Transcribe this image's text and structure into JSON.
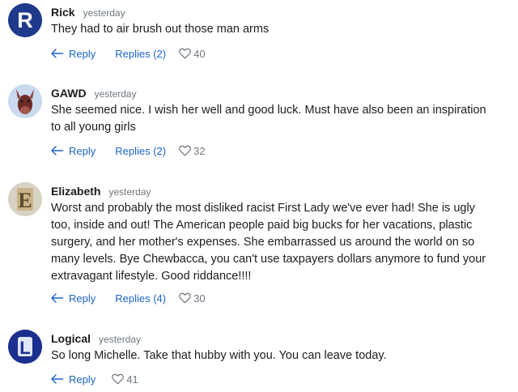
{
  "comments": [
    {
      "author": "Rick",
      "time": "yesterday",
      "text": "They had to air brush out those man arms",
      "reply_label": "Reply",
      "replies_label": "Replies (2)",
      "likes": "40",
      "avatar_letter": "R",
      "avatar_color": "#1f3a8a"
    },
    {
      "author": "GAWD",
      "time": "yesterday",
      "text_lines": [
        "She seemed nice. I wish her well and good luck. Must have also been an inspiration",
        "to all young girls"
      ],
      "reply_label": "Reply",
      "replies_label": "Replies (2)",
      "likes": "32",
      "avatar_color": "#c9d9ee"
    },
    {
      "author": "Elizabeth",
      "time": "yesterday",
      "text_lines": [
        "Worst and probably the most disliked racist First Lady we've ever had! She is ugly",
        "too, inside and out! The American people paid big bucks for her vacations, plastic",
        "surgery, and her mother's expenses. She embarrassed us around the world on so",
        "many levels. Bye Chewbacca, you can't use taxpayers dollars anymore to fund your",
        "extravagant lifestyle. Good riddance!!!!"
      ],
      "reply_label": "Reply",
      "replies_label": "Replies (4)",
      "likes": "30",
      "avatar_letter": "E",
      "avatar_color": "#d8d2c4"
    },
    {
      "author": "Logical",
      "time": "yesterday",
      "text": "So long Michelle. Take that hubby with you. You can leave today.",
      "reply_label": "Reply",
      "likes": "41",
      "avatar_letter": "L",
      "avatar_color": "#1b2f8f"
    }
  ],
  "colors": {
    "link": "#1c64c8",
    "muted": "#6e7780",
    "text": "#1d1d1f"
  },
  "icons": [
    "reply-arrow-icon",
    "heart-icon"
  ]
}
